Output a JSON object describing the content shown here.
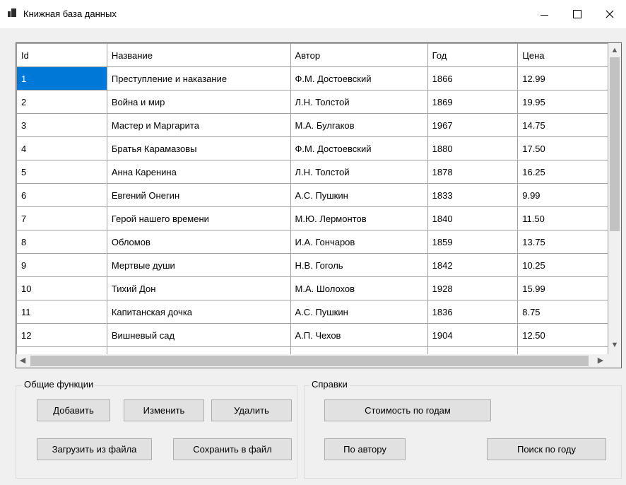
{
  "window": {
    "title": "Книжная база данных",
    "controls": {
      "minimize": "—",
      "maximize": "☐",
      "close": "✕"
    }
  },
  "grid": {
    "columns": [
      "Id",
      "Название",
      "Автор",
      "Год",
      "Цена"
    ],
    "rows": [
      [
        "1",
        "Преступление и наказание",
        "Ф.М. Достоевский",
        "1866",
        "12.99"
      ],
      [
        "2",
        "Война и мир",
        "Л.Н. Толстой",
        "1869",
        "19.95"
      ],
      [
        "3",
        "Мастер и Маргарита",
        "М.А. Булгаков",
        "1967",
        "14.75"
      ],
      [
        "4",
        "Братья Карамазовы",
        "Ф.М. Достоевский",
        "1880",
        "17.50"
      ],
      [
        "5",
        "Анна Каренина",
        "Л.Н. Толстой",
        "1878",
        "16.25"
      ],
      [
        "6",
        "Евгений Онегин",
        "А.С. Пушкин",
        "1833",
        "9.99"
      ],
      [
        "7",
        "Герой нашего времени",
        "М.Ю. Лермонтов",
        "1840",
        "11.50"
      ],
      [
        "8",
        "Обломов",
        "И.А. Гончаров",
        "1859",
        "13.75"
      ],
      [
        "9",
        "Мертвые души",
        "Н.В. Гоголь",
        "1842",
        "10.25"
      ],
      [
        "10",
        "Тихий Дон",
        "М.А. Шолохов",
        "1928",
        "15.99"
      ],
      [
        "11",
        "Капитанская дочка",
        "А.С. Пушкин",
        "1836",
        "8.75"
      ],
      [
        "12",
        "Вишневый сад",
        "А.П. Чехов",
        "1904",
        "12.50"
      ]
    ],
    "selected_cell": "1",
    "selection_color": "#0078d7"
  },
  "groups": {
    "general": {
      "title": "Общие функции",
      "add": "Добавить",
      "edit": "Изменить",
      "delete": "Удалить",
      "load": "Загрузить из файла",
      "save": "Сохранить в файл"
    },
    "reports": {
      "title": "Справки",
      "cost_by_year": "Стоимость по годам",
      "by_author": "По автору",
      "search_year": "Поиск по году"
    }
  }
}
